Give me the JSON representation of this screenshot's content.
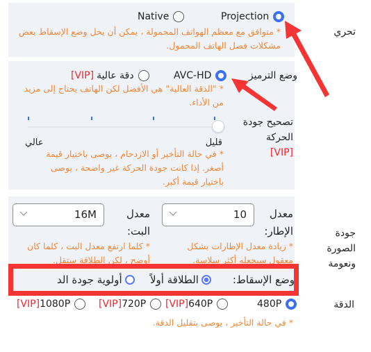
{
  "accent_colors": {
    "primary": "#3b6ff5",
    "hint": "#f0883a",
    "vip": "#f5222d",
    "annotation": "#f53434",
    "panel_bg": "#eff2f6"
  },
  "drive": {
    "label": "تحري",
    "options": [
      {
        "label": "Projection",
        "checked": true
      },
      {
        "label": "Native",
        "checked": false
      }
    ],
    "hint": "* متوافق مع معظم الهواتف المحمولة ، يمكن أن يحل وضع الإسقاط بعض مشكلات فصل الهاتف المحمول."
  },
  "encoding": {
    "label": "وضع الترميز",
    "options": [
      {
        "label": "AVC-HD",
        "checked": true
      },
      {
        "label": "دقة عالية",
        "vip": "[VIP]",
        "checked": false
      }
    ],
    "hint": "* \"الدقة العالية\" هي الأفضل لكن الهاتف يحتاج إلى مزيد من الأداء."
  },
  "motion": {
    "label": "تصحيح جودة الحركة",
    "vip": "[VIP]",
    "slider": {
      "value_index": 0,
      "steps": 4,
      "min_label": "قليل",
      "max_label": "عالي"
    },
    "hint": "* في حالة التأخير أو الازدحام ، يوصى باختيار قيمة أصغر. إذا كانت جودة الحركة غير واضحة ، يوصى باختيار قيمة أكبر."
  },
  "quality": {
    "label": "جودة الصورة ونعومة",
    "frame_rate": {
      "label": "معدل الإطار:",
      "value": "10",
      "hint": "* زيادة معدل الإطارات بشكل معقول سيجعله أكثر سلاسة."
    },
    "bitrate": {
      "label": "معدل البت:",
      "value": "16M",
      "hint": "* كلما ارتفع معدل البت ، كلما كان أوضح ، لكن الطلاقة ستقل."
    },
    "projection_mode": {
      "label": "وضع الإسقاط:",
      "options": [
        {
          "label": "الطلاقة أولاً",
          "checked": true
        },
        {
          "label": "أولوية جودة الد",
          "checked": false
        }
      ]
    }
  },
  "resolution": {
    "label": "الدقة",
    "options": [
      {
        "label": "480P",
        "vip": "",
        "checked": true
      },
      {
        "label": "640P",
        "vip": "[VIP]",
        "checked": false
      },
      {
        "label": "720P",
        "vip": "[VIP]",
        "checked": false
      },
      {
        "label": "1080P",
        "vip": "[VIP]",
        "checked": false
      }
    ],
    "hint": "* في حالة التأخير ، يوصى بتقليل الدقة."
  }
}
